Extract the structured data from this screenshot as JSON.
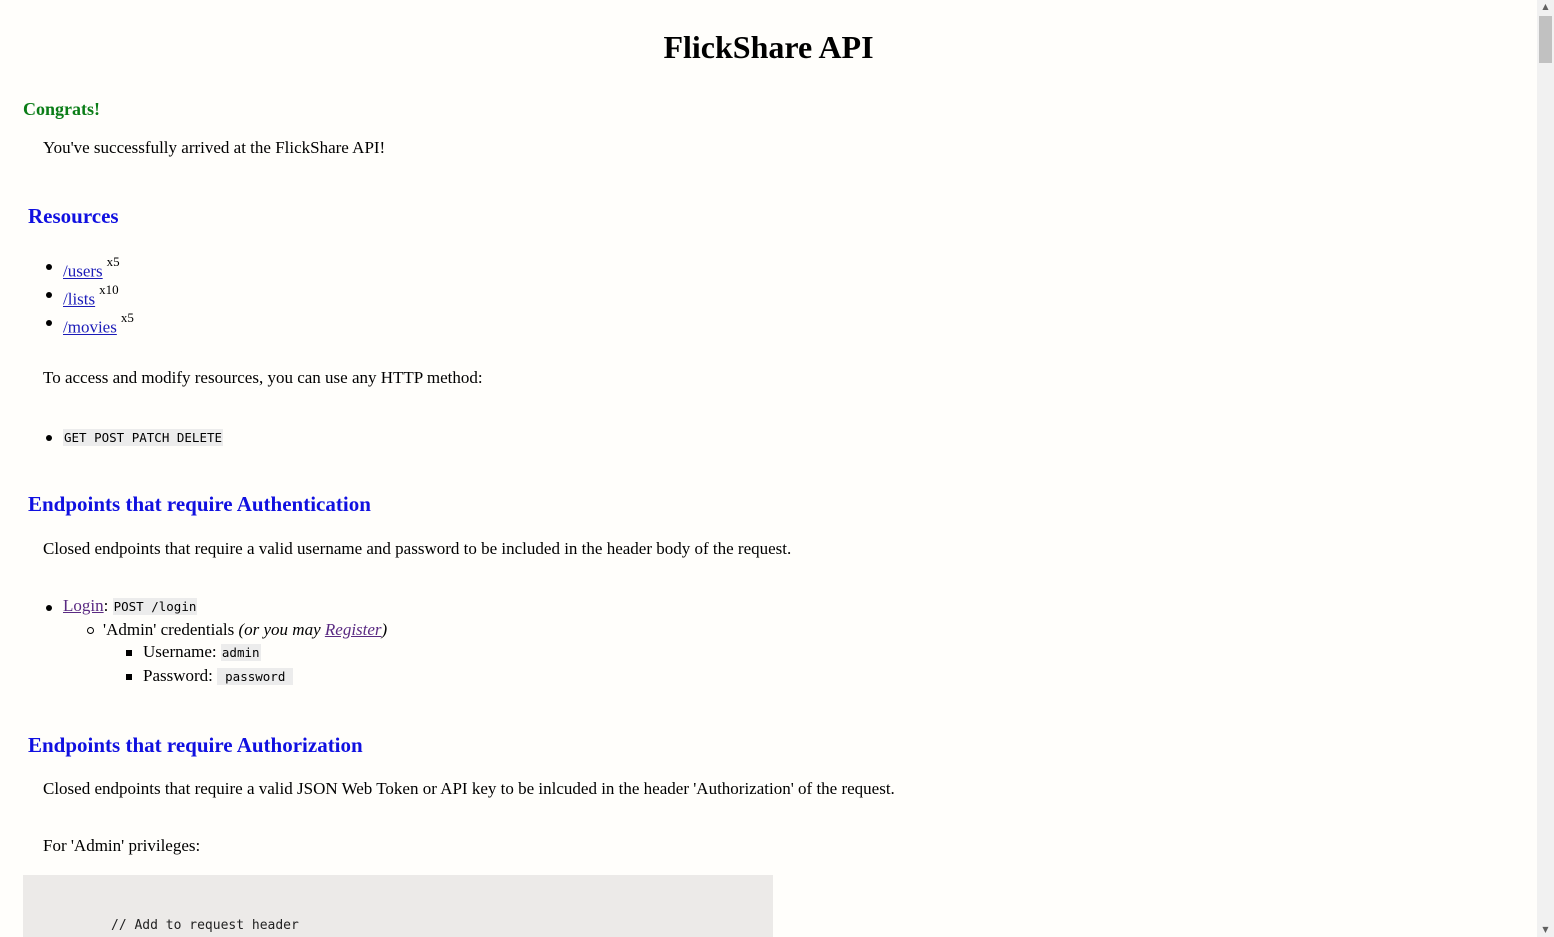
{
  "header": {
    "title": "FlickShare API"
  },
  "intro": {
    "congrats": "Congrats!",
    "message": "You've successfully arrived at the FlickShare API!"
  },
  "resources": {
    "heading": "Resources",
    "items": [
      {
        "label": "/users",
        "count": "x5"
      },
      {
        "label": "/lists",
        "count": "x10"
      },
      {
        "label": "/movies",
        "count": "x5"
      }
    ],
    "methods_text": "To access and modify resources, you can use any HTTP method:",
    "methods": "GET POST PATCH DELETE"
  },
  "authentication": {
    "heading": "Endpoints that require Authentication",
    "description": "Closed endpoints that require a valid username and password to be included in the header body of the request.",
    "login_label": "Login",
    "login_colon": ":",
    "login_code": "POST /login",
    "admin_credentials": "'Admin' credentials",
    "or_you_may": "(or you may",
    "register_label": "Register",
    "close_paren": ")",
    "username_label": "Username:",
    "username_value": "admin",
    "password_label": "Password:",
    "password_value": "password"
  },
  "authorization": {
    "heading": "Endpoints that require Authorization",
    "description": "Closed endpoints that require a valid JSON Web Token or API key to be inlcuded in the header 'Authorization' of the request.",
    "admin_privileges": "For 'Admin' privileges:",
    "code_comment": "// Add to request header"
  },
  "scrollbar": {
    "up_icon": "triangle-up",
    "down_icon": "triangle-down"
  }
}
